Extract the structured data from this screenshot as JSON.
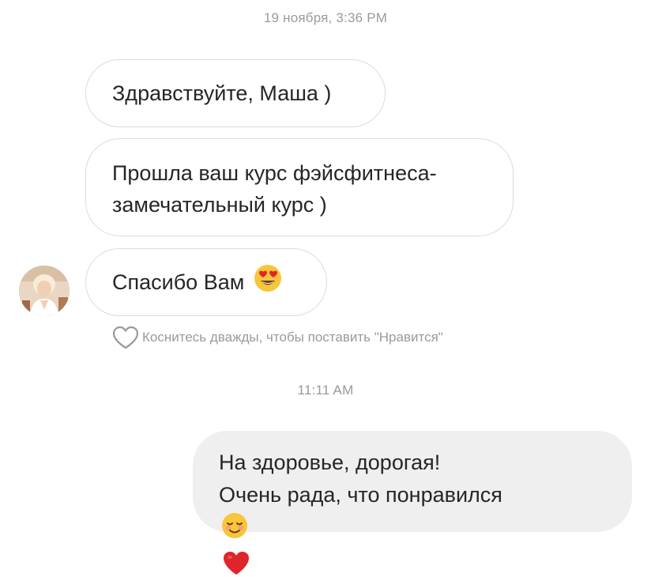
{
  "thread": {
    "timestamp_1": "19 ноября, 3:36 PM",
    "timestamp_2": "11:11 AM",
    "incoming": [
      {
        "text": "Здравствуйте, Маша )"
      },
      {
        "line1": "Прошла ваш курс фэйсфитнеса-",
        "line2": "замечательный курс )"
      },
      {
        "text": "Спасибо Вам",
        "emoji": "heart-eyes-emoji"
      }
    ],
    "like_hint": "Коснитесь дважды, чтобы поставить \"Нравится\"",
    "outgoing": {
      "line1": "На здоровье, дорогая!",
      "line2": "Очень рада, что понравился",
      "emojis": [
        "smiling-face-emoji",
        "red-heart-emoji"
      ]
    }
  },
  "colors": {
    "incoming_border": "#dbdbdb",
    "outgoing_bg": "#efefef",
    "meta_text": "#9a9a9a",
    "heart_red": "#e0242b",
    "emoji_yellow": "#f8c63a"
  }
}
